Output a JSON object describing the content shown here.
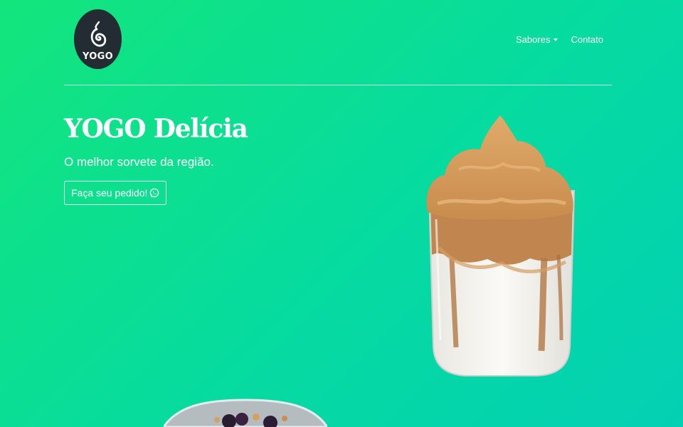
{
  "brand": {
    "logo_text": "YOGO",
    "colors": {
      "logo_bg": "#232c33",
      "bg_start": "#13e57c",
      "bg_end": "#03d0b4"
    }
  },
  "nav": {
    "items": [
      {
        "label": "Sabores",
        "has_dropdown": true
      },
      {
        "label": "Contato",
        "has_dropdown": false
      }
    ]
  },
  "hero": {
    "title": "YOGO Delícia",
    "subtitle": "O melhor sorvete da região.",
    "cta_label": "Faça seu pedido!",
    "cta_icon": "whatsapp-icon"
  },
  "images": {
    "product": "dalgona-coffee-glass",
    "bowl": "acai-bowl-partial"
  }
}
